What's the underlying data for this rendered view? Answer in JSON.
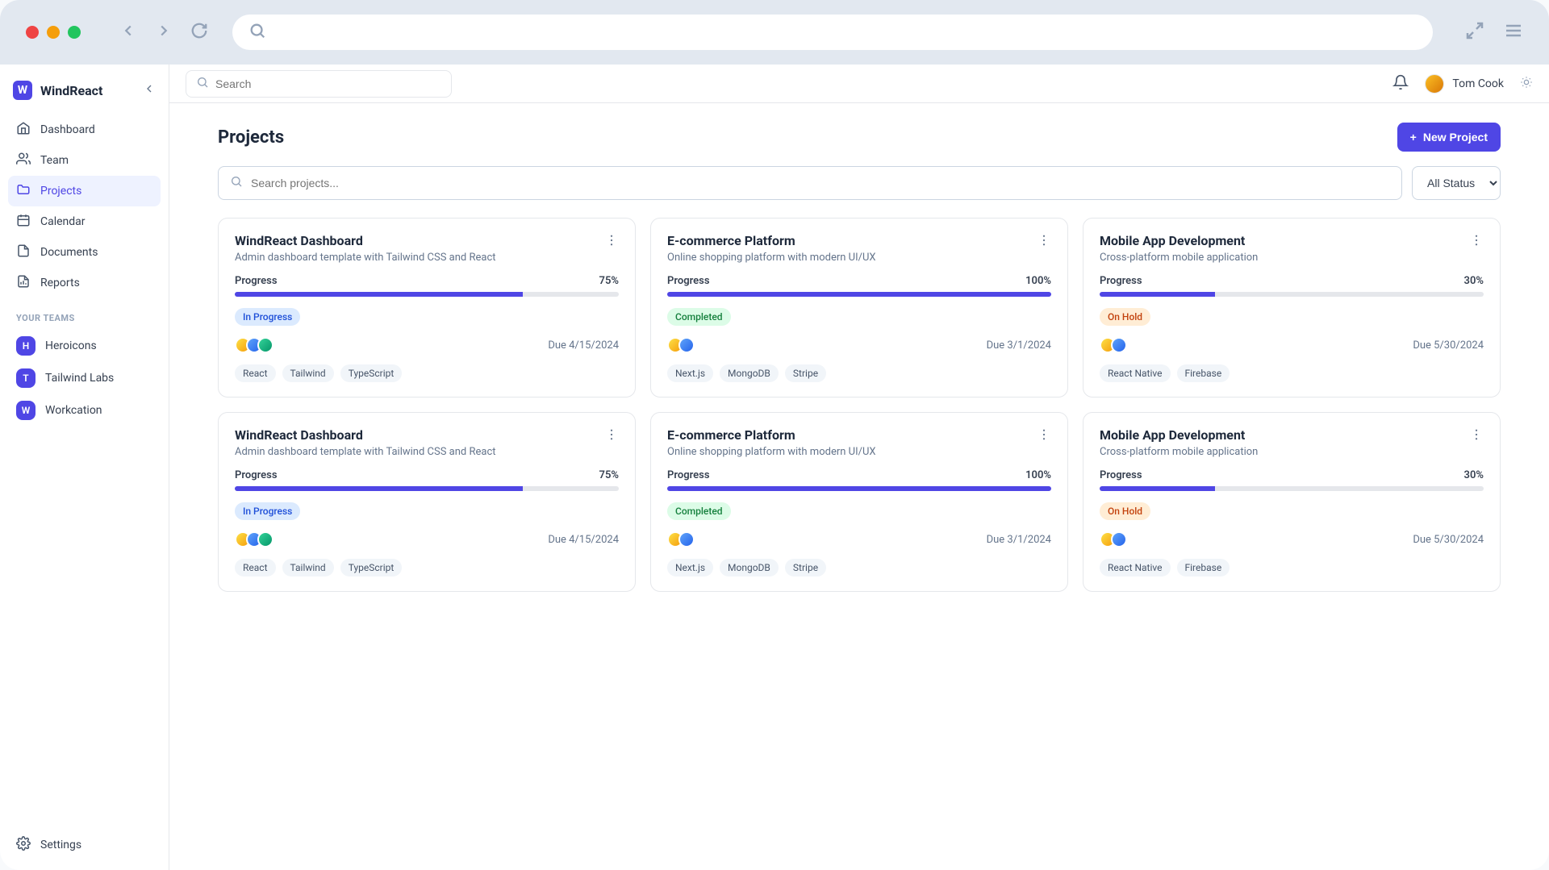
{
  "brand": {
    "logo_letter": "W",
    "name": "WindReact"
  },
  "sidebar": {
    "nav": [
      {
        "label": "Dashboard",
        "name": "dashboard"
      },
      {
        "label": "Team",
        "name": "team"
      },
      {
        "label": "Projects",
        "name": "projects",
        "active": true
      },
      {
        "label": "Calendar",
        "name": "calendar"
      },
      {
        "label": "Documents",
        "name": "documents"
      },
      {
        "label": "Reports",
        "name": "reports"
      }
    ],
    "section_label": "YOUR TEAMS",
    "teams": [
      {
        "badge": "H",
        "label": "Heroicons"
      },
      {
        "badge": "T",
        "label": "Tailwind Labs"
      },
      {
        "badge": "W",
        "label": "Workcation"
      }
    ],
    "settings_label": "Settings"
  },
  "topbar": {
    "search_placeholder": "Search",
    "user_name": "Tom Cook"
  },
  "page": {
    "title": "Projects",
    "new_button_label": "New Project",
    "search_placeholder": "Search projects...",
    "status_filter": {
      "selected": "All Status"
    },
    "progress_label": "Progress"
  },
  "statuses": {
    "inprogress": "In Progress",
    "completed": "Completed",
    "onhold": "On Hold"
  },
  "projects": [
    {
      "title": "WindReact Dashboard",
      "desc": "Admin dashboard template with Tailwind CSS and React",
      "progress": 75,
      "progress_text": "75%",
      "status": "inprogress",
      "due": "Due 4/15/2024",
      "avatars": 3,
      "tags": [
        "React",
        "Tailwind",
        "TypeScript"
      ]
    },
    {
      "title": "E-commerce Platform",
      "desc": "Online shopping platform with modern UI/UX",
      "progress": 100,
      "progress_text": "100%",
      "status": "completed",
      "due": "Due 3/1/2024",
      "avatars": 2,
      "tags": [
        "Next.js",
        "MongoDB",
        "Stripe"
      ]
    },
    {
      "title": "Mobile App Development",
      "desc": "Cross-platform mobile application",
      "progress": 30,
      "progress_text": "30%",
      "status": "onhold",
      "due": "Due 5/30/2024",
      "avatars": 2,
      "tags": [
        "React Native",
        "Firebase"
      ]
    },
    {
      "title": "WindReact Dashboard",
      "desc": "Admin dashboard template with Tailwind CSS and React",
      "progress": 75,
      "progress_text": "75%",
      "status": "inprogress",
      "due": "Due 4/15/2024",
      "avatars": 3,
      "tags": [
        "React",
        "Tailwind",
        "TypeScript"
      ]
    },
    {
      "title": "E-commerce Platform",
      "desc": "Online shopping platform with modern UI/UX",
      "progress": 100,
      "progress_text": "100%",
      "status": "completed",
      "due": "Due 3/1/2024",
      "avatars": 2,
      "tags": [
        "Next.js",
        "MongoDB",
        "Stripe"
      ]
    },
    {
      "title": "Mobile App Development",
      "desc": "Cross-platform mobile application",
      "progress": 30,
      "progress_text": "30%",
      "status": "onhold",
      "due": "Due 5/30/2024",
      "avatars": 2,
      "tags": [
        "React Native",
        "Firebase"
      ]
    }
  ]
}
